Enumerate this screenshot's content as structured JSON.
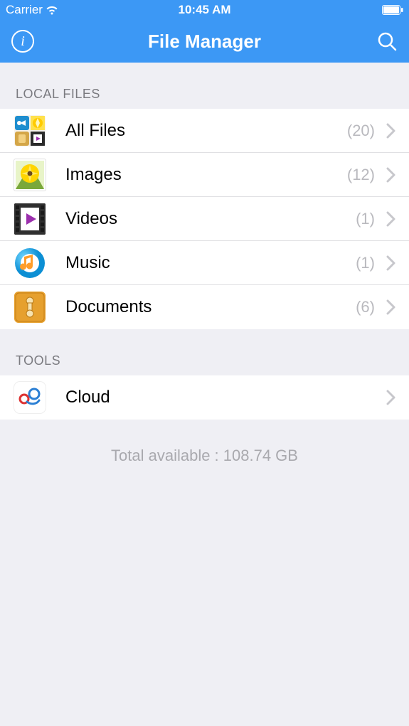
{
  "status": {
    "carrier": "Carrier",
    "time": "10:45 AM"
  },
  "nav": {
    "title": "File Manager"
  },
  "sections": {
    "local": {
      "header": "LOCAL FILES",
      "items": [
        {
          "label": "All Files",
          "count": "(20)"
        },
        {
          "label": "Images",
          "count": "(12)"
        },
        {
          "label": "Videos",
          "count": "(1)"
        },
        {
          "label": "Music",
          "count": "(1)"
        },
        {
          "label": "Documents",
          "count": "(6)"
        }
      ]
    },
    "tools": {
      "header": "TOOLS",
      "items": [
        {
          "label": "Cloud"
        }
      ]
    }
  },
  "footer": {
    "text": "Total available : 108.74 GB"
  }
}
